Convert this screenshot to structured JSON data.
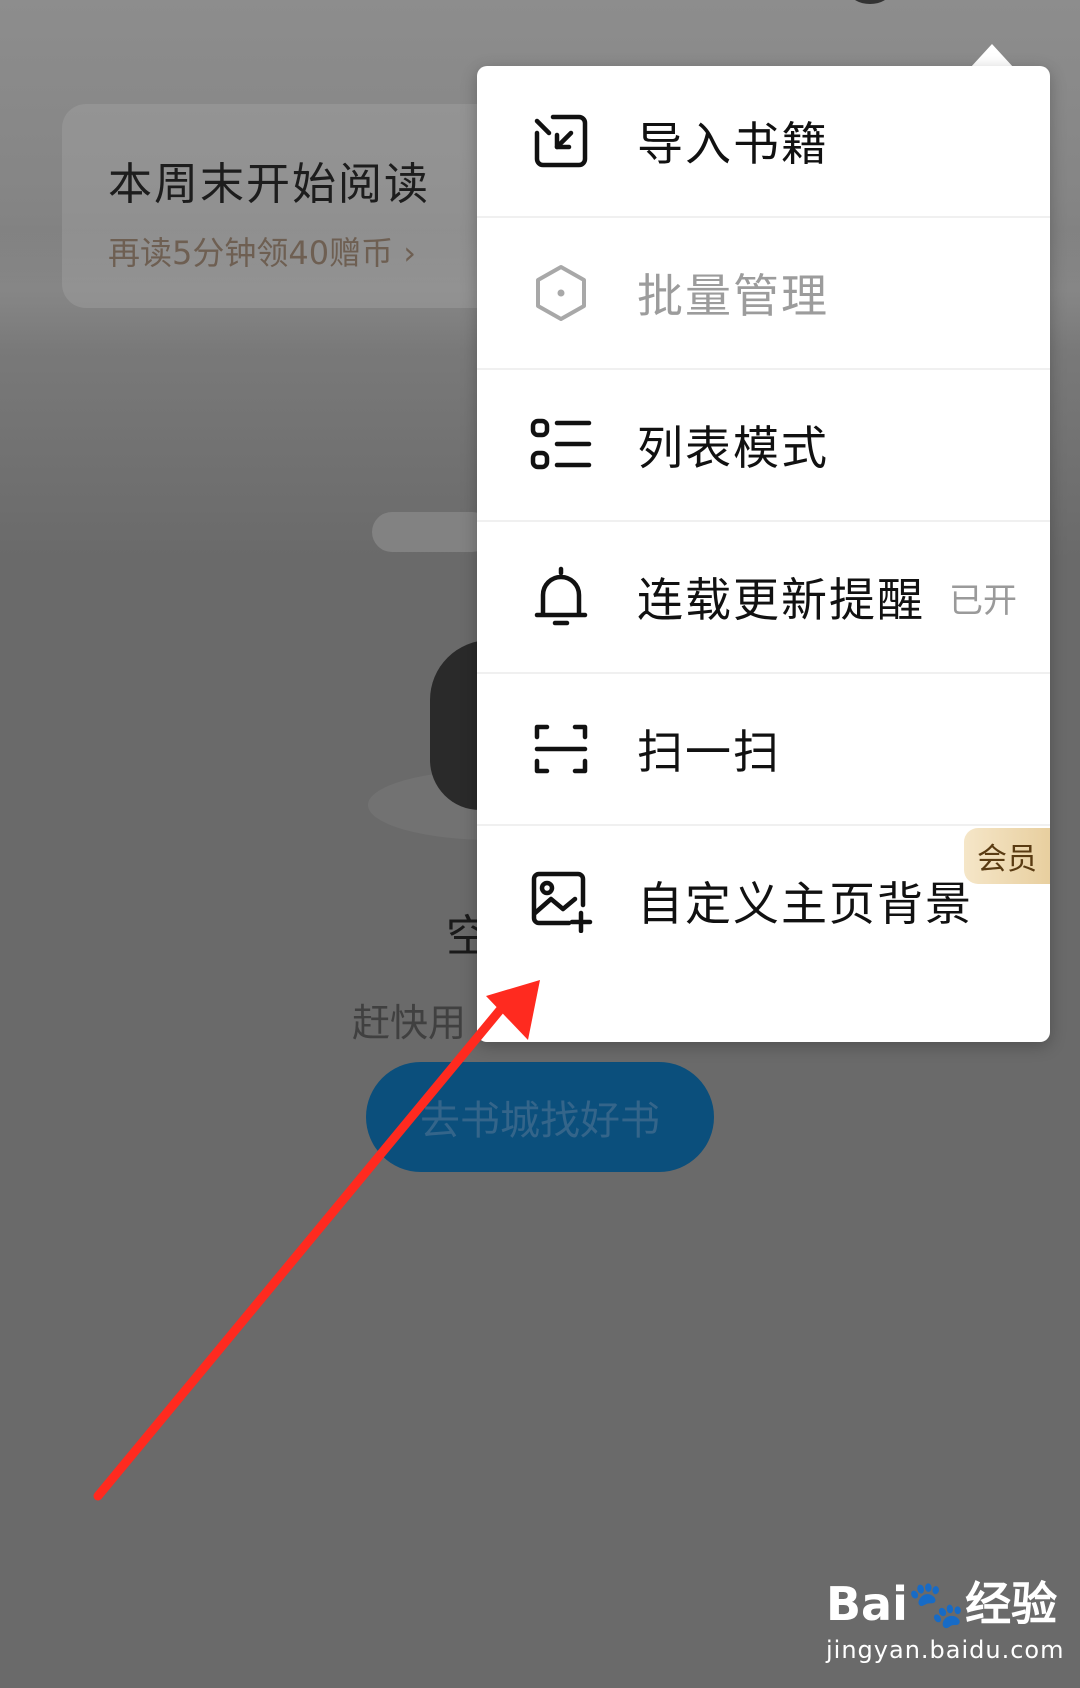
{
  "reading_card": {
    "title": "本周末开始阅读",
    "subtitle": "再读5分钟领40赠币 ›"
  },
  "empty_state": {
    "title": "空",
    "subtitle": "赶快用",
    "button_label": "去书城找好书"
  },
  "menu": {
    "items": [
      {
        "label": "导入书籍",
        "icon": "import-book-icon"
      },
      {
        "label": "批量管理",
        "icon": "hexagon-icon",
        "disabled": true
      },
      {
        "label": "列表模式",
        "icon": "list-icon"
      },
      {
        "label": "连载更新提醒",
        "icon": "bell-icon",
        "status": "已开"
      },
      {
        "label": "扫一扫",
        "icon": "scan-icon"
      },
      {
        "label": "自定义主页背景",
        "icon": "image-add-icon",
        "badge": "会员"
      }
    ]
  },
  "watermark": {
    "logo": "Bai🐾经验",
    "url": "jingyan.baidu.com"
  },
  "colors": {
    "overlay_bg": "#6a6a6a",
    "menu_bg": "#ffffff",
    "button_bg": "#0b4f7c",
    "arrow": "#ff2a1f",
    "vip_badge": "#e8cf9f"
  }
}
